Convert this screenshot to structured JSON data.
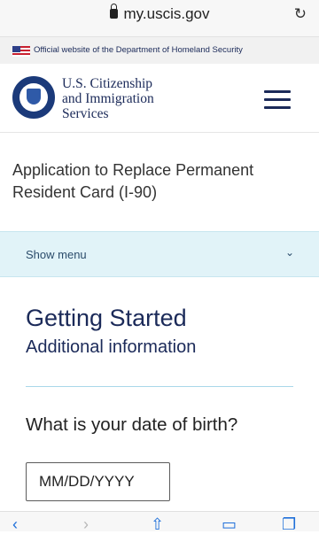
{
  "browser": {
    "url": "my.uscis.gov",
    "reload_icon": "reload-icon",
    "lock_icon": "lock-icon"
  },
  "gov_banner": {
    "text": "Official website of the Department of Homeland Security",
    "flag_icon": "us-flag-icon"
  },
  "header": {
    "seal_icon": "dhs-seal-icon",
    "agency_line1": "U.S. Citizenship",
    "agency_line2": "and Immigration",
    "agency_line3": "Services",
    "menu_icon": "hamburger-menu-icon"
  },
  "application": {
    "title_line1": "Application to Replace Permanent",
    "title_line2": "Resident Card (I-90)"
  },
  "show_menu": {
    "label": "Show menu",
    "chevron": "⌄"
  },
  "main": {
    "heading": "Getting Started",
    "subheading": "Additional information",
    "question": "What is your date of birth?",
    "dob_placeholder": "MM/DD/YYYY",
    "dob_value": ""
  },
  "toolbar": {
    "icons": [
      "back-icon",
      "forward-icon",
      "share-icon",
      "bookmarks-icon",
      "tabs-icon"
    ]
  },
  "colors": {
    "navy": "#1b2a59",
    "menu_bg": "#e1f3f8",
    "divider": "#a9d8ea",
    "link_blue": "#1e6fd9"
  }
}
